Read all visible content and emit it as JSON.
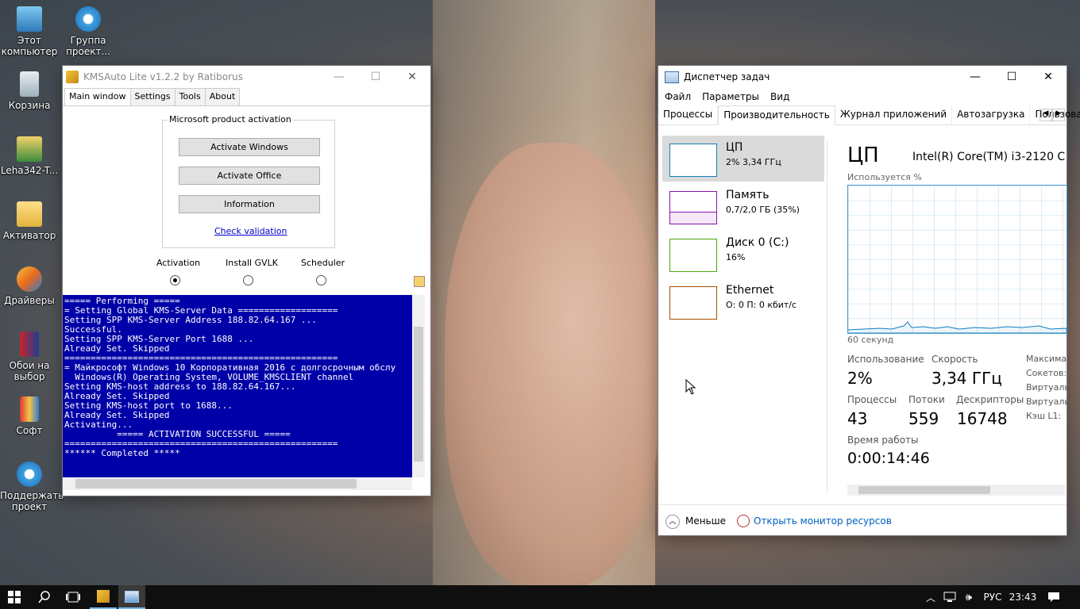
{
  "desktop": {
    "icons": [
      {
        "label": "Этот компьютер",
        "icon": "computer-icon"
      },
      {
        "label": "Группа проект...",
        "icon": "ie-icon"
      },
      {
        "label": "Корзина",
        "icon": "recycle-bin-icon"
      },
      {
        "label": "Leha342-T...",
        "icon": "user-icon"
      },
      {
        "label": "Активатор",
        "icon": "folder-icon"
      },
      {
        "label": "Драйверы",
        "icon": "drivers-icon"
      },
      {
        "label": "Обои на выбор",
        "icon": "wallpaper-icon"
      },
      {
        "label": "Софт",
        "icon": "soft-icon"
      },
      {
        "label": "Поддержать проект",
        "icon": "ie-icon"
      }
    ]
  },
  "kms": {
    "title": "KMSAuto Lite v1.2.2 by Ratiborus",
    "tabs": [
      "Main window",
      "Settings",
      "Tools",
      "About"
    ],
    "group_title": "Microsoft product activation",
    "buttons": [
      "Activate Windows",
      "Activate Office",
      "Information"
    ],
    "check_link": "Check validation",
    "modes": [
      "Activation",
      "Install GVLK",
      "Scheduler"
    ],
    "selected_mode": "Activation",
    "console": [
      "===== Performing =====",
      "= Setting Global KMS-Server Data ===================",
      "Setting SPP KMS-Server Address 188.82.64.167 ...",
      "Successful.",
      "Setting SPP KMS-Server Port 1688 ...",
      "Already Set. Skipped",
      "====================================================",
      "= Майкрософт Windows 10 Корпоративная 2016 с долгосрочным обслу",
      "  Windows(R) Operating System, VOLUME_KMSCLIENT channel",
      "Setting KMS-host address to 188.82.64.167...",
      "Already Set. Skipped",
      "Setting KMS-host port to 1688...",
      "Already Set. Skipped",
      "Activating...",
      "          ===== ACTIVATION SUCCESSFUL =====",
      "====================================================",
      "****** Completed *****"
    ]
  },
  "tm": {
    "title": "Диспетчер задач",
    "menu": [
      "Файл",
      "Параметры",
      "Вид"
    ],
    "tabs": [
      "Процессы",
      "Производительность",
      "Журнал приложений",
      "Автозагрузка",
      "Пользоват"
    ],
    "active_tab": "Производительность",
    "side": [
      {
        "name": "ЦП",
        "value": "2% 3,34 ГГц",
        "color": "#117dbb"
      },
      {
        "name": "Память",
        "value": "0,7/2,0 ГБ (35%)",
        "color": "#8b12ae"
      },
      {
        "name": "Диск 0 (C:)",
        "value": "16%",
        "color": "#4da60c"
      },
      {
        "name": "Ethernet",
        "value": "О: 0 П: 0 кбит/с",
        "color": "#a74f01"
      }
    ],
    "header": "ЦП",
    "cpu_model": "Intel(R) Core(TM) i3-2120 C",
    "graph_label": "Используется %",
    "graph_time": "60 секунд",
    "stats": {
      "usage_label": "Использование",
      "usage": "2%",
      "speed_label": "Скорость",
      "speed": "3,34 ГГц",
      "proc_label": "Процессы",
      "proc": "43",
      "threads_label": "Потоки",
      "threads": "559",
      "handles_label": "Дескрипторы",
      "handles": "16748",
      "uptime_label": "Время работы",
      "uptime": "0:00:14:46",
      "right_labels": [
        "Максима",
        "Сокетов:",
        "Виртуаль",
        "Виртуаль",
        "Кэш L1:"
      ]
    },
    "less": "Меньше",
    "monitor_link": "Открыть монитор ресурсов"
  },
  "taskbar": {
    "lang": "РУС",
    "time": "23:43"
  }
}
